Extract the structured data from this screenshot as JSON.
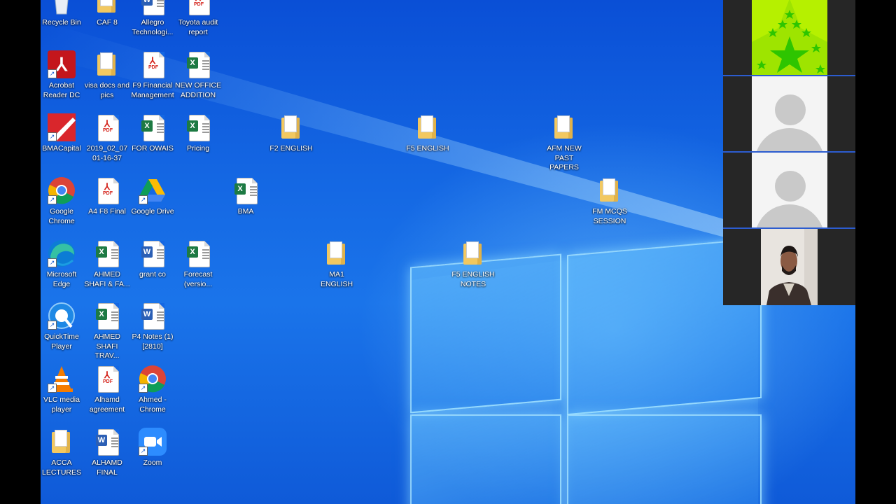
{
  "desktop": {
    "icons": [
      {
        "label": "Recycle Bin",
        "type": "recycle"
      },
      {
        "label": "CAF 8",
        "type": "folder"
      },
      {
        "label": "Allegro Technologi...",
        "type": "word"
      },
      {
        "label": "Toyota audit report",
        "type": "pdf"
      },
      {
        "label": "Acrobat Reader DC",
        "type": "acrobat"
      },
      {
        "label": "visa docs and pics",
        "type": "folder"
      },
      {
        "label": "F9 Financial Management",
        "type": "pdf"
      },
      {
        "label": "NEW OFFICE ADDITION",
        "type": "excel"
      },
      {
        "label": "BMACapital",
        "type": "bma"
      },
      {
        "label": "2019_02_07 01-16-37",
        "type": "pdf"
      },
      {
        "label": "FOR OWAIS",
        "type": "excel"
      },
      {
        "label": "Pricing",
        "type": "excel"
      },
      {
        "label": "F2 ENGLISH",
        "type": "folder"
      },
      {
        "label": "F5 ENGLISH",
        "type": "folder"
      },
      {
        "label": "AFM NEW PAST PAPERS",
        "type": "folder"
      },
      {
        "label": "Google Chrome",
        "type": "chrome"
      },
      {
        "label": "A4 F8 Final",
        "type": "pdf"
      },
      {
        "label": "Google Drive",
        "type": "drive"
      },
      {
        "label": "BMA",
        "type": "excel"
      },
      {
        "label": "FM MCQS SESSION",
        "type": "folder"
      },
      {
        "label": "Microsoft Edge",
        "type": "edge"
      },
      {
        "label": "AHMED SHAFI & FA...",
        "type": "excel"
      },
      {
        "label": "grant co",
        "type": "word"
      },
      {
        "label": "Forecast (versio...",
        "type": "excel"
      },
      {
        "label": "MA1 ENGLISH",
        "type": "folder"
      },
      {
        "label": "F5 ENGLISH NOTES",
        "type": "folder"
      },
      {
        "label": "QuickTime Player",
        "type": "quicktime"
      },
      {
        "label": "AHMED SHAFI TRAV...",
        "type": "excel"
      },
      {
        "label": "P4 Notes (1)[2810]",
        "type": "word"
      },
      {
        "label": "VLC media player",
        "type": "vlc"
      },
      {
        "label": "Alhamd agreement",
        "type": "pdf"
      },
      {
        "label": "Ahmed - Chrome",
        "type": "chrome"
      },
      {
        "label": "ACCA LECTURES",
        "type": "folder"
      },
      {
        "label": "ALHAMD FINAL",
        "type": "word"
      },
      {
        "label": "Zoom",
        "type": "zoom"
      }
    ]
  },
  "glyphs": {
    "pdf": "PDF",
    "x": "X",
    "w": "W",
    "acrobat": "⅄",
    "shortcut": "↗"
  },
  "video_panel": {
    "tiles": [
      {
        "kind": "image",
        "colors": [
          "#b6f000",
          "#2ec500"
        ]
      },
      {
        "kind": "placeholder"
      },
      {
        "kind": "placeholder"
      },
      {
        "kind": "camera"
      }
    ]
  }
}
